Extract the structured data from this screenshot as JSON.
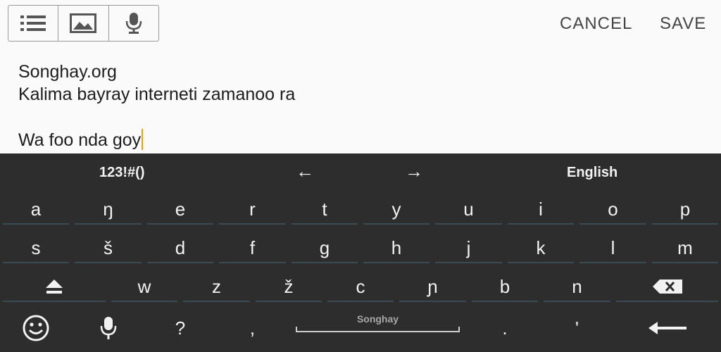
{
  "toolbar": {
    "icons": [
      "list-icon",
      "image-icon",
      "microphone-icon"
    ],
    "cancel_label": "CANCEL",
    "save_label": "SAVE"
  },
  "editor": {
    "lines": [
      "Songhay.org",
      "Kalima bayray interneti zamanoo ra",
      "",
      "Wa foo nda goy"
    ],
    "cursor_color": "#e8a100"
  },
  "keyboard": {
    "background": "#2d2d2d",
    "suggestions": [
      "123!#()",
      "←",
      "→",
      "English"
    ],
    "row1": [
      "a",
      "ŋ",
      "e",
      "r",
      "t",
      "y",
      "u",
      "i",
      "o",
      "p"
    ],
    "row2": [
      "s",
      "š",
      "d",
      "f",
      "g",
      "h",
      "j",
      "k",
      "l",
      "m"
    ],
    "row3": [
      "w",
      "z",
      "ž",
      "c",
      "ɲ",
      "b",
      "n"
    ],
    "row3_icons": [
      "shift-icon",
      "backspace-icon"
    ],
    "row4": {
      "icons": [
        "emoji-icon",
        "microphone-icon",
        "enter-icon"
      ],
      "question": "?",
      "comma": ",",
      "space_label": "Songhay",
      "period": ".",
      "apostrophe": "'"
    }
  }
}
